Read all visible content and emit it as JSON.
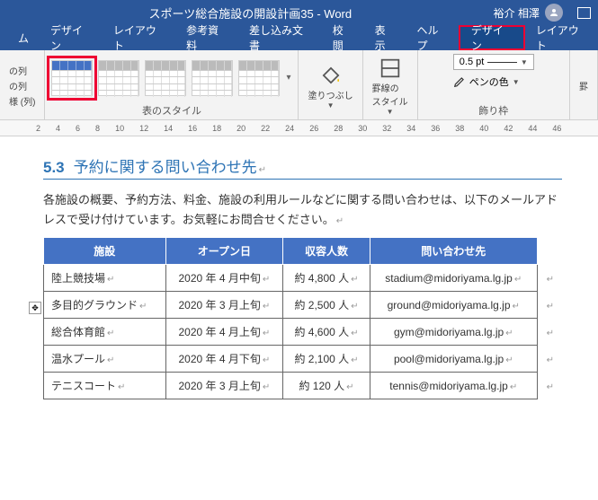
{
  "titlebar": {
    "title": "スポーツ総合施設の開設計画35 - Word",
    "user": "裕介 相澤"
  },
  "menu": {
    "items": [
      "ム",
      "デザイン",
      "レイアウト",
      "参考資料",
      "差し込み文書",
      "校閲",
      "表示",
      "ヘルプ",
      "デザイン",
      "レイアウト"
    ],
    "highlight_index": 8
  },
  "ribbon": {
    "col_opts": [
      "の列",
      "の列",
      "様 (列)"
    ],
    "styles_label": "表のスタイル",
    "fill_label": "塗りつぶし",
    "border_style_label": "罫線の\nスタイル",
    "pt": "0.5 pt",
    "pen_color": "ペンの色",
    "border_group_label": "飾り枠",
    "border_btn": "罫"
  },
  "ruler": [
    "2",
    "4",
    "6",
    "8",
    "10",
    "12",
    "14",
    "16",
    "18",
    "20",
    "22",
    "24",
    "26",
    "28",
    "30",
    "32",
    "34",
    "36",
    "38",
    "40",
    "42",
    "44",
    "46"
  ],
  "document": {
    "section_number": "5.3",
    "section_title": "予約に関する問い合わせ先",
    "paragraph": "各施設の概要、予約方法、料金、施設の利用ルールなどに関する問い合わせは、以下のメールアドレスで受け付けています。お気軽にお問合せください。",
    "table": {
      "headers": [
        "施設",
        "オープン日",
        "収容人数",
        "問い合わせ先"
      ],
      "rows": [
        {
          "facility": "陸上競技場",
          "open": "2020 年 4 月中旬",
          "capacity": "約 4,800 人",
          "contact": "stadium@midoriyama.lg.jp"
        },
        {
          "facility": "多目的グラウンド",
          "open": "2020 年 3 月上旬",
          "capacity": "約 2,500 人",
          "contact": "ground@midoriyama.lg.jp"
        },
        {
          "facility": "総合体育館",
          "open": "2020 年 4 月上旬",
          "capacity": "約 4,600 人",
          "contact": "gym@midoriyama.lg.jp"
        },
        {
          "facility": "温水プール",
          "open": "2020 年 4 月下旬",
          "capacity": "約 2,100 人",
          "contact": "pool@midoriyama.lg.jp"
        },
        {
          "facility": "テニスコート",
          "open": "2020 年 3 月上旬",
          "capacity": "約 120 人",
          "contact": "tennis@midoriyama.lg.jp"
        }
      ]
    }
  }
}
